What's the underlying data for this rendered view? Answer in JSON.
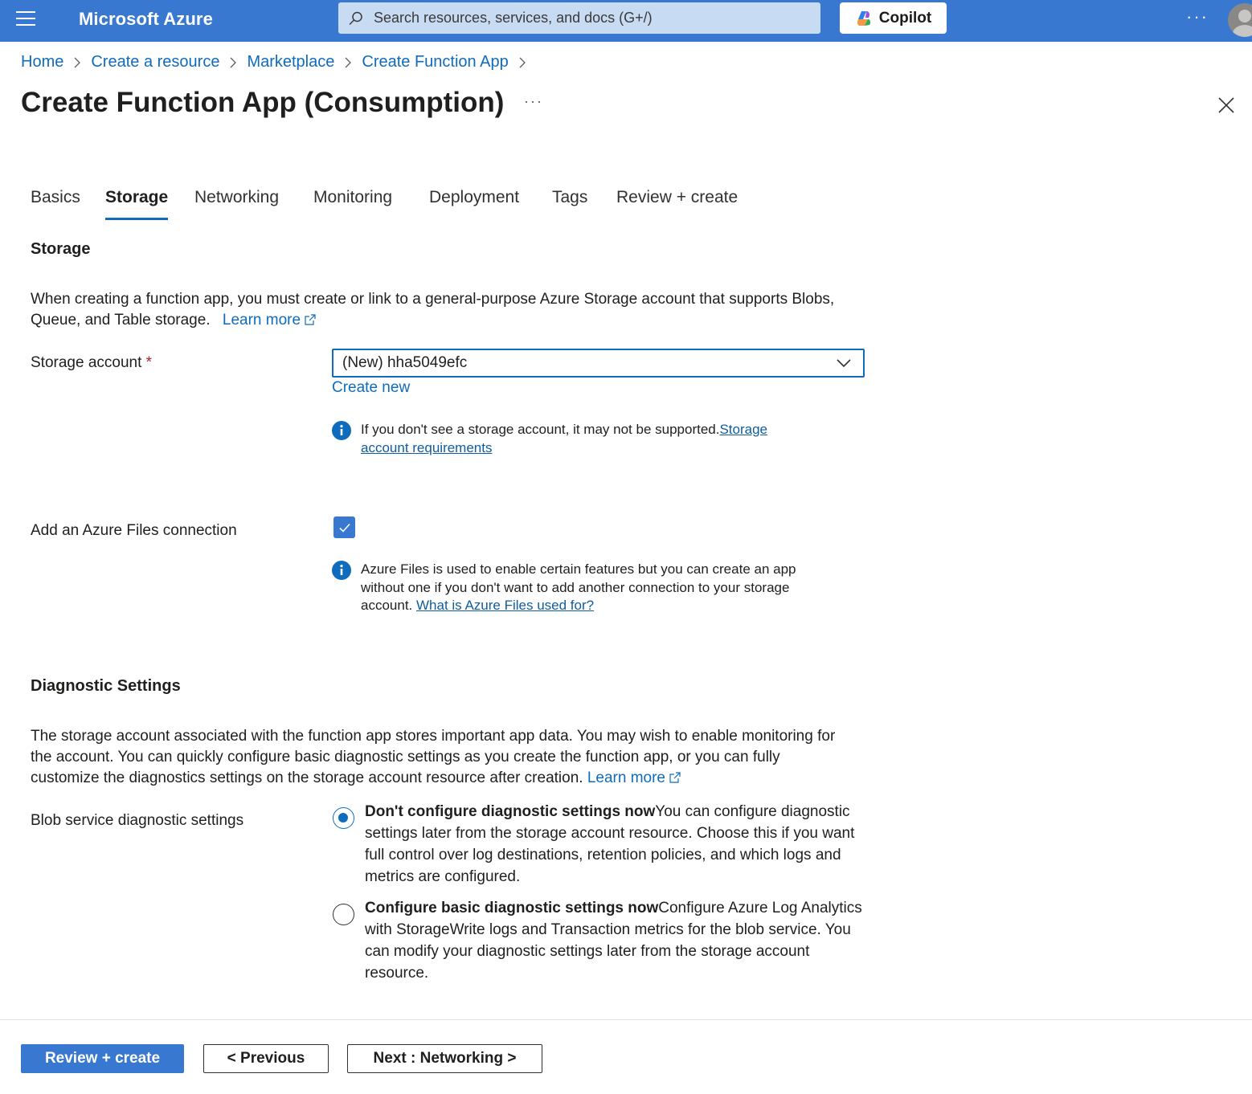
{
  "colors": {
    "brand_bar": "#3878d0",
    "link": "#0f6cbd",
    "required": "#a4262c",
    "primary_button": "#3878d0"
  },
  "topbar": {
    "brand": "Microsoft Azure",
    "search_placeholder": "Search resources, services, and docs (G+/)",
    "copilot_label": "Copilot",
    "more_icon": "ellipsis-icon",
    "avatar_icon": "user-avatar-icon"
  },
  "breadcrumb": [
    "Home",
    "Create a resource",
    "Marketplace",
    "Create Function App"
  ],
  "page": {
    "title": "Create Function App (Consumption)",
    "more": "···"
  },
  "tabs": [
    "Basics",
    "Storage",
    "Networking",
    "Monitoring",
    "Deployment",
    "Tags",
    "Review + create"
  ],
  "active_tab": "Storage",
  "storage": {
    "heading": "Storage",
    "intro_line1": "When creating a function app, you must create or link to a general-purpose Azure Storage account that supports Blobs,",
    "intro_line2": "Queue, and Table storage.",
    "learn_more": "Learn more",
    "account_label": "Storage account",
    "required_mark": "*",
    "account_value": "(New) hha5049efc",
    "create_new": "Create new",
    "info1_text": "If you don't see a storage account, it may not be supported.",
    "info1_link": "Storage account requirements",
    "files_label": "Add an Azure Files connection",
    "files_checked": true,
    "info2_text": "Azure Files is used to enable certain features but you can create an app without one if you don't want to add another connection to your storage account.",
    "info2_link": "What is Azure Files used for?"
  },
  "diagnostics": {
    "heading": "Diagnostic Settings",
    "intro_line1": "The storage account associated with the function app stores important app data. You may wish to enable monitoring for",
    "intro_line2": "the account. You can quickly configure basic diagnostic settings as you create the function app, or you can fully",
    "intro_line3": "customize the diagnostics settings on the storage account resource after creation.",
    "learn_more": "Learn more",
    "blob_label": "Blob service diagnostic settings",
    "option1_title": "Don't configure diagnostic settings now",
    "option1_desc": "You can configure diagnostic settings later from the storage account resource. Choose this if you want full control over log destinations, retention policies, and which logs and metrics are configured.",
    "option1_selected": true,
    "option2_title": "Configure basic diagnostic settings now",
    "option2_desc": "Configure Azure Log Analytics with StorageWrite logs and Transaction metrics for the blob service. You can modify your diagnostic settings later from the storage account resource.",
    "option2_selected": false
  },
  "footer": {
    "review_create": "Review + create",
    "previous": "< Previous",
    "next": "Next : Networking >"
  }
}
